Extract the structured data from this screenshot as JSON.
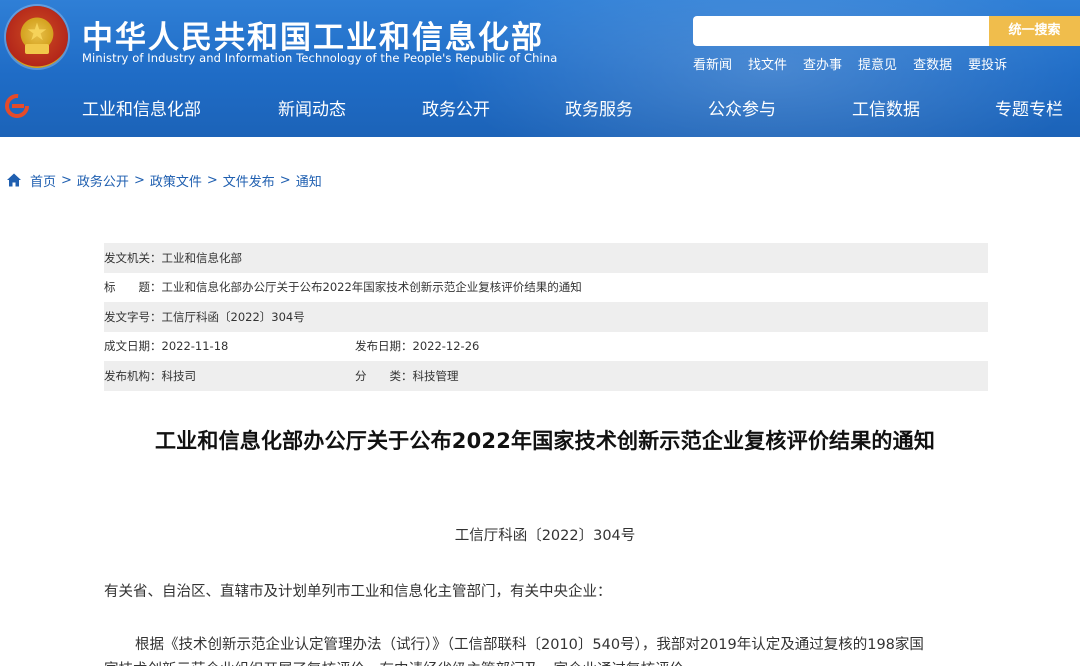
{
  "header": {
    "title": "中华人民共和国工业和信息化部",
    "subtitle": "Ministry of Industry and Information Technology of the People's Republic of China",
    "search": {
      "placeholder": "",
      "button_label": "统一搜索"
    },
    "quick_links": [
      "看新闻",
      "找文件",
      "查办事",
      "提意见",
      "查数据",
      "要投诉"
    ],
    "nav": [
      "工业和信息化部",
      "新闻动态",
      "政务公开",
      "政务服务",
      "公众参与",
      "工信数据",
      "专题专栏"
    ]
  },
  "breadcrumb": [
    "首页",
    "政务公开",
    "政策文件",
    "文件发布",
    "通知"
  ],
  "meta": {
    "issuer_label": "发文机关：",
    "issuer": "工业和信息化部",
    "title_label": "标　　题：",
    "title": "工业和信息化部办公厅关于公布2022年国家技术创新示范企业复核评价结果的通知",
    "doc_no_label": "发文字号：",
    "doc_no": "工信厅科函〔2022〕304号",
    "created_label": "成文日期：",
    "created": "2022-11-18",
    "published_label": "发布日期：",
    "published": "2022-12-26",
    "agency_label": "发布机构：",
    "agency": "科技司",
    "category_label": "分　　类：",
    "category": "科技管理"
  },
  "document": {
    "title": "工业和信息化部办公厅关于公布2022年国家技术创新示范企业复核评价结果的通知",
    "number": "工信厅科函〔2022〕304号",
    "recipients": "有关省、自治区、直辖市及计划单列市工业和信息化主管部门，有关中央企业：",
    "paragraph1_line1": "根据《技术创新示范企业认定管理办法（试行）》（工信部联科〔2010〕540号），我部对2019年认定及通过复核的198家国",
    "paragraph1_line2": "家技术创新示范企业组织开展了复核评价。有中请经省级主管部门及…家企业通过复核评价。"
  },
  "colors": {
    "header_blue": "#1f6cc6",
    "search_button": "#f0bd4c",
    "link_blue": "#1f5fb0",
    "meta_shade": "#eeeeee"
  }
}
